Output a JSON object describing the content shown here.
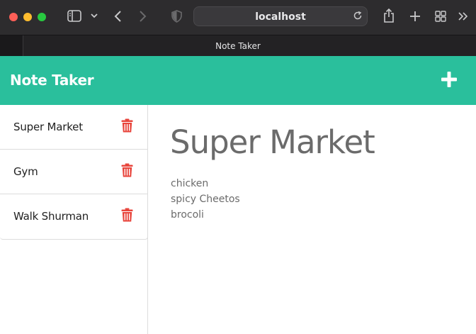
{
  "browser": {
    "address": "localhost",
    "tab_title": "Note Taker"
  },
  "app": {
    "brand": "Note Taker",
    "accent_color": "#2abf9c",
    "delete_color": "#e8453c",
    "add_icon": "plus-icon",
    "delete_icon": "trash-icon"
  },
  "notes": [
    {
      "title": "Super Market"
    },
    {
      "title": "Gym"
    },
    {
      "title": "Walk Shurman"
    }
  ],
  "active_note": {
    "title": "Super Market",
    "text": "chicken\nspicy Cheetos\nbrocoli"
  }
}
